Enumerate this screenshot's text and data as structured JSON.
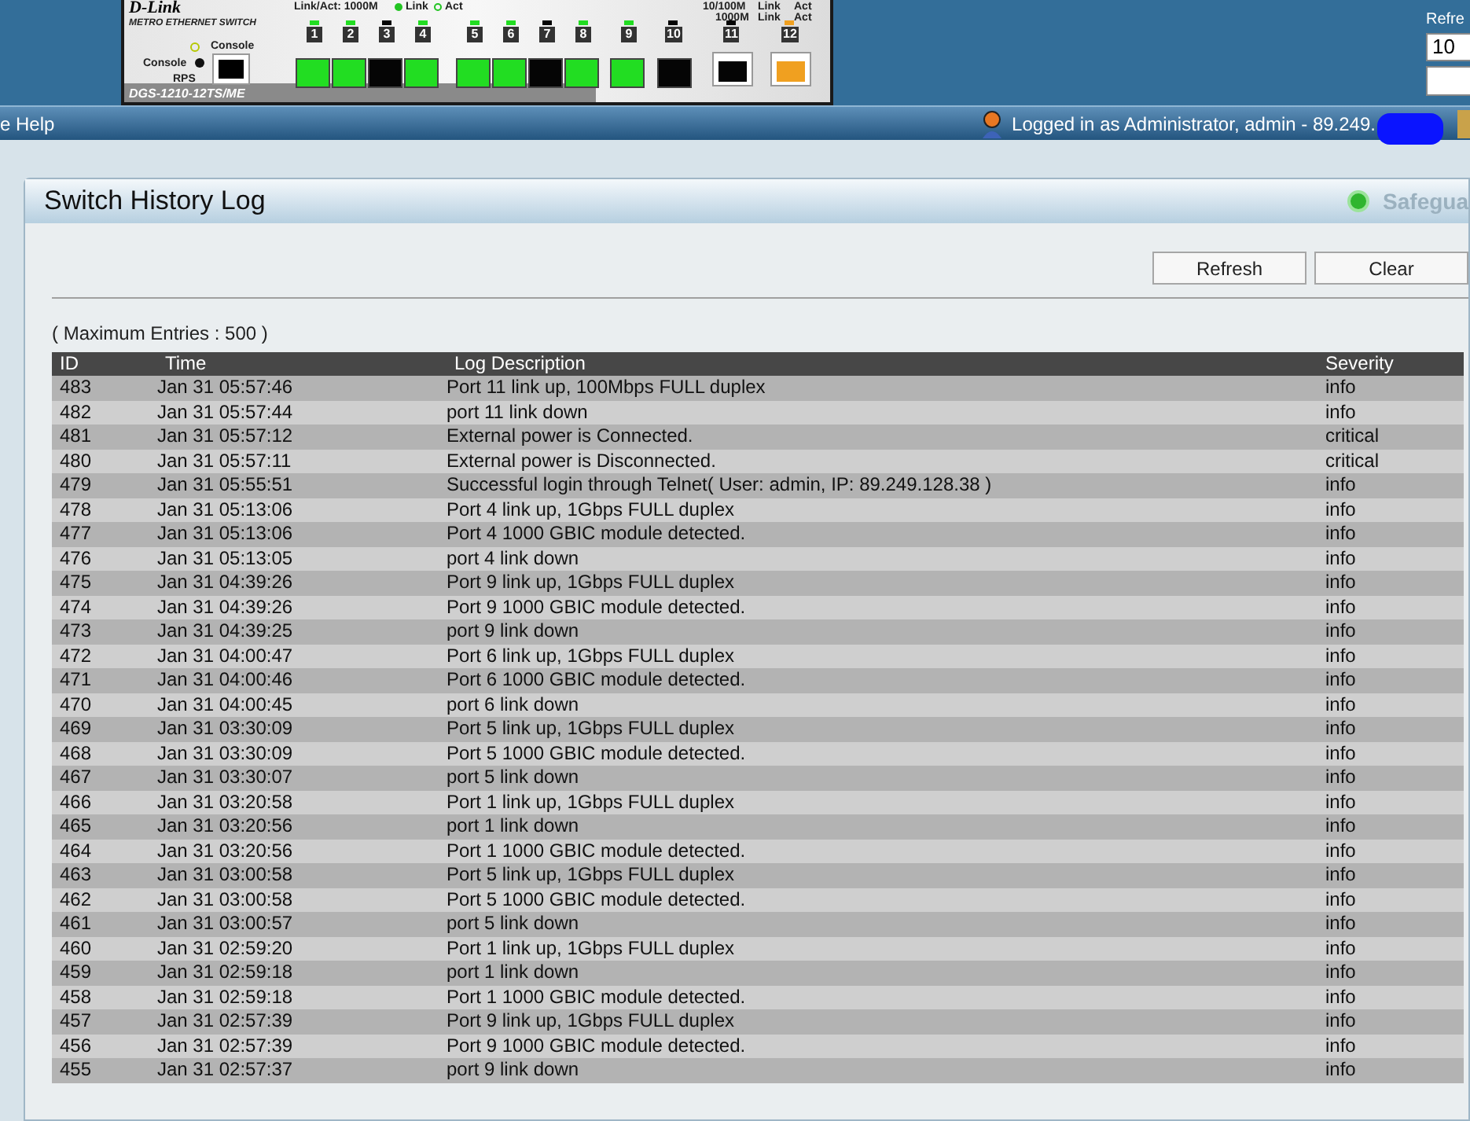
{
  "device": {
    "brand": "D-Link",
    "subtitle": "METRO ETHERNET SWITCH",
    "legend_left": "Link/Act: 1000M",
    "legend_link": "Link",
    "legend_act": "Act",
    "legend_right_top": "10/100M",
    "legend_right_bottom": "1000M",
    "legend_right_link_top": "Link",
    "legend_right_act_top": "Act",
    "legend_right_link_bottom": "Link",
    "legend_right_act_bottom": "Act",
    "console_port_label": "Console",
    "console_led_label": "Console",
    "rps_label": "RPS",
    "model": "DGS-1210-12TS/ME",
    "ports": [
      {
        "label": "1",
        "kind": "sfp",
        "color": "#22dd22"
      },
      {
        "label": "2",
        "kind": "sfp",
        "color": "#22dd22"
      },
      {
        "label": "3",
        "kind": "sfp",
        "color": "#050505"
      },
      {
        "label": "4",
        "kind": "sfp",
        "color": "#22dd22"
      },
      {
        "label": "5",
        "kind": "sfp",
        "color": "#22dd22"
      },
      {
        "label": "6",
        "kind": "sfp",
        "color": "#22dd22"
      },
      {
        "label": "7",
        "kind": "sfp",
        "color": "#050505"
      },
      {
        "label": "8",
        "kind": "sfp",
        "color": "#22dd22"
      },
      {
        "label": "9",
        "kind": "sfp",
        "color": "#22dd22"
      },
      {
        "label": "10",
        "kind": "sfp",
        "color": "#050505"
      },
      {
        "label": "11",
        "kind": "rj45",
        "color": "#050505"
      },
      {
        "label": "12",
        "kind": "rj45",
        "color": "#f0a020"
      }
    ]
  },
  "refresh_panel": {
    "label": "Refre",
    "value": "10"
  },
  "menu_bar": {
    "item": "e Help",
    "login": "Logged in as Administrator, admin - 89.249."
  },
  "page": {
    "title": "Switch History Log",
    "safeguard": "Safegua",
    "buttons": [
      "Refresh",
      "Clear"
    ],
    "max_entries": "( Maximum Entries : 500 )"
  },
  "table": {
    "columns": [
      "ID",
      "Time",
      "Log Description",
      "Severity"
    ],
    "rows": [
      {
        "id": "483",
        "time": "Jan 31 05:57:46",
        "description": "Port 11 link up, 100Mbps FULL duplex",
        "severity": "info"
      },
      {
        "id": "482",
        "time": "Jan 31 05:57:44",
        "description": "port 11 link down",
        "severity": "info"
      },
      {
        "id": "481",
        "time": "Jan 31 05:57:12",
        "description": "External power is Connected.",
        "severity": "critical"
      },
      {
        "id": "480",
        "time": "Jan 31 05:57:11",
        "description": "External power is Disconnected.",
        "severity": "critical"
      },
      {
        "id": "479",
        "time": "Jan 31 05:55:51",
        "description": "Successful login through Telnet( User: admin, IP: 89.249.128.38 )",
        "severity": "info"
      },
      {
        "id": "478",
        "time": "Jan 31 05:13:06",
        "description": "Port 4 link up, 1Gbps FULL duplex",
        "severity": "info"
      },
      {
        "id": "477",
        "time": "Jan 31 05:13:06",
        "description": "Port 4 1000 GBIC module detected.",
        "severity": "info"
      },
      {
        "id": "476",
        "time": "Jan 31 05:13:05",
        "description": "port 4 link down",
        "severity": "info"
      },
      {
        "id": "475",
        "time": "Jan 31 04:39:26",
        "description": "Port 9 link up, 1Gbps FULL duplex",
        "severity": "info"
      },
      {
        "id": "474",
        "time": "Jan 31 04:39:26",
        "description": "Port 9 1000 GBIC module detected.",
        "severity": "info"
      },
      {
        "id": "473",
        "time": "Jan 31 04:39:25",
        "description": "port 9 link down",
        "severity": "info"
      },
      {
        "id": "472",
        "time": "Jan 31 04:00:47",
        "description": "Port 6 link up, 1Gbps FULL duplex",
        "severity": "info"
      },
      {
        "id": "471",
        "time": "Jan 31 04:00:46",
        "description": "Port 6 1000 GBIC module detected.",
        "severity": "info"
      },
      {
        "id": "470",
        "time": "Jan 31 04:00:45",
        "description": "port 6 link down",
        "severity": "info"
      },
      {
        "id": "469",
        "time": "Jan 31 03:30:09",
        "description": "Port 5 link up, 1Gbps FULL duplex",
        "severity": "info"
      },
      {
        "id": "468",
        "time": "Jan 31 03:30:09",
        "description": "Port 5 1000 GBIC module detected.",
        "severity": "info"
      },
      {
        "id": "467",
        "time": "Jan 31 03:30:07",
        "description": "port 5 link down",
        "severity": "info"
      },
      {
        "id": "466",
        "time": "Jan 31 03:20:58",
        "description": "Port 1 link up, 1Gbps FULL duplex",
        "severity": "info"
      },
      {
        "id": "465",
        "time": "Jan 31 03:20:56",
        "description": "port 1 link down",
        "severity": "info"
      },
      {
        "id": "464",
        "time": "Jan 31 03:20:56",
        "description": "Port 1 1000 GBIC module detected.",
        "severity": "info"
      },
      {
        "id": "463",
        "time": "Jan 31 03:00:58",
        "description": "Port 5 link up, 1Gbps FULL duplex",
        "severity": "info"
      },
      {
        "id": "462",
        "time": "Jan 31 03:00:58",
        "description": "Port 5 1000 GBIC module detected.",
        "severity": "info"
      },
      {
        "id": "461",
        "time": "Jan 31 03:00:57",
        "description": "port 5 link down",
        "severity": "info"
      },
      {
        "id": "460",
        "time": "Jan 31 02:59:20",
        "description": "Port 1 link up, 1Gbps FULL duplex",
        "severity": "info"
      },
      {
        "id": "459",
        "time": "Jan 31 02:59:18",
        "description": "port 1 link down",
        "severity": "info"
      },
      {
        "id": "458",
        "time": "Jan 31 02:59:18",
        "description": "Port 1 1000 GBIC module detected.",
        "severity": "info"
      },
      {
        "id": "457",
        "time": "Jan 31 02:57:39",
        "description": "Port 9 link up, 1Gbps FULL duplex",
        "severity": "info"
      },
      {
        "id": "456",
        "time": "Jan 31 02:57:39",
        "description": "Port 9 1000 GBIC module detected.",
        "severity": "info"
      },
      {
        "id": "455",
        "time": "Jan 31 02:57:37",
        "description": "port 9 link down",
        "severity": "info"
      }
    ]
  }
}
